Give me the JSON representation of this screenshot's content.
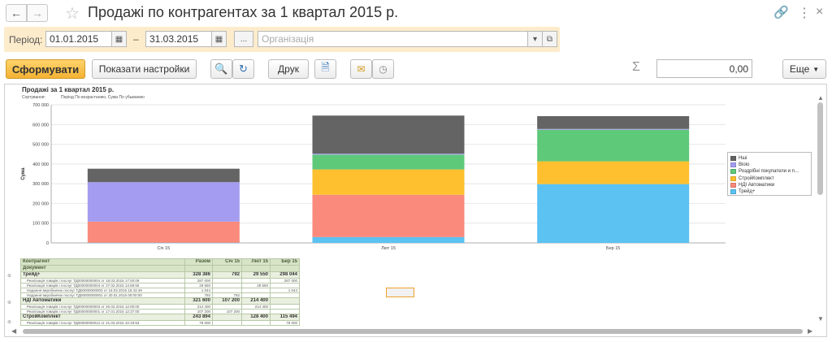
{
  "window": {
    "title": "Продажі по контрагентах за 1 квартал 2015 р."
  },
  "filters": {
    "period_label": "Період:",
    "date_from": "01.01.2015",
    "dash": "–",
    "date_to": "31.03.2015",
    "more_label": "...",
    "org_placeholder": "Організація"
  },
  "toolbar": {
    "generate_label": "Сформувати",
    "settings_label": "Показати настройки",
    "print_label": "Друк",
    "sigma": "Σ",
    "sum_value": "0,00",
    "more_label": "Еще"
  },
  "report": {
    "title": "Продажі за 1 квартал 2015 р.",
    "sort_label": "Сортування:",
    "sort_value": "Період По возрастанию, Сума По убыванию"
  },
  "chart_data": {
    "type": "bar",
    "stacked": true,
    "categories": [
      "Січ 15",
      "Лют 15",
      "Бер 15"
    ],
    "ylabel": "Сума",
    "ylim": [
      0,
      700000
    ],
    "yticks": [
      "0",
      "100 000",
      "200 000",
      "300 000",
      "400 000",
      "500 000",
      "600 000",
      "700 000"
    ],
    "grid": true,
    "legend": "right",
    "series": [
      {
        "name": "Трейд+",
        "color": "#5bc2f2",
        "values": [
          792,
          29550,
          298044
        ]
      },
      {
        "name": "НДІ Автоматики",
        "color": "#f98a7c",
        "values": [
          107200,
          214400,
          0
        ]
      },
      {
        "name": "СтройКомплект",
        "color": "#fec02e",
        "values": [
          0,
          128400,
          115494
        ]
      },
      {
        "name": "Роздрібні покупатели и прочие",
        "color": "#5fc97a",
        "values": [
          0,
          75000,
          160000
        ]
      },
      {
        "name": "Віоіо",
        "color": "#a39cf0",
        "values": [
          200000,
          5000,
          4000
        ]
      },
      {
        "name": "Нші",
        "color": "#646464",
        "values": [
          68000,
          193000,
          65000
        ]
      }
    ]
  },
  "table": {
    "headers": [
      "Контрагент",
      "Разом",
      "Січ 15",
      "Лют 15",
      "Бер 15"
    ],
    "subheader": "Документ",
    "rows": [
      {
        "kind": "grp",
        "cells": [
          "Трейд+",
          "328 386",
          "792",
          "29 550",
          "298 044"
        ]
      },
      {
        "kind": "det",
        "cells": [
          "Реалізація товарів і послуг ТД00000000004 от 18.03.2015 17:00:09",
          "287 000",
          "",
          "",
          "287 000"
        ]
      },
      {
        "kind": "det",
        "cells": [
          "Реалізація товарів і послуг ТД00000000004 от 27.02.2015 14:59:55",
          "29 550",
          "",
          "29 550",
          ""
        ]
      },
      {
        "kind": "det",
        "cells": [
          "Надання виробничих послуг ТД00000000003 от 18.03.2015 15:43:49",
          "1 044",
          "",
          "",
          "1 044"
        ]
      },
      {
        "kind": "det",
        "cells": [
          "Надання виробничих послуг ТД00000000001 от 30.01.2015 00:00:00",
          "792",
          "792",
          "",
          ""
        ]
      },
      {
        "kind": "grp",
        "cells": [
          "НДІ Автоматики",
          "321 600",
          "107 200",
          "214 400",
          ""
        ]
      },
      {
        "kind": "det",
        "cells": [
          "Реалізація товарів і послуг ТД00000000003 от 20.02.2015 12:00:00",
          "214 400",
          "",
          "214 400",
          ""
        ]
      },
      {
        "kind": "det",
        "cells": [
          "Реалізація товарів і послуг ТД00000000001 от 17.01.2015 12:37:00",
          "107 200",
          "107 200",
          "",
          ""
        ]
      },
      {
        "kind": "grp",
        "cells": [
          "СтройКомплект",
          "243 894",
          "",
          "128 400",
          "115 494"
        ]
      },
      {
        "kind": "det",
        "cells": [
          "Реалізація товарів і послуг ТД00000000012 от 21.03.2015 10:19:53",
          "79 000",
          "",
          "",
          "79 000"
        ]
      }
    ]
  }
}
